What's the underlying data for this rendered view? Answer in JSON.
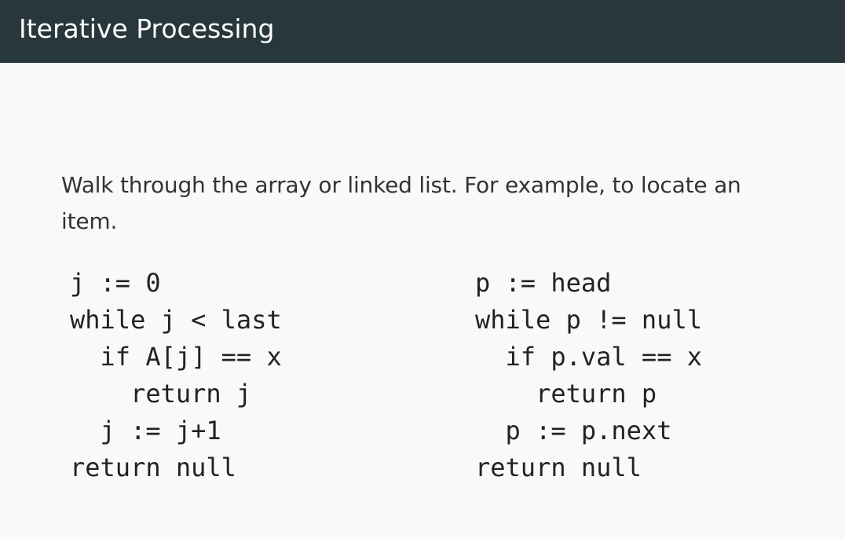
{
  "header": {
    "title": "Iterative Processing"
  },
  "body": {
    "intro": "Walk through the array or linked list. For example, to locate an item."
  },
  "code": {
    "array": [
      "j := 0",
      "while j < last",
      "  if A[j] == x",
      "    return j",
      "  j := j+1",
      "return null"
    ],
    "list": [
      "p := head",
      "while p != null",
      "  if p.val == x",
      "    return p",
      "  p := p.next",
      "return null"
    ]
  },
  "colors": {
    "header_background": "#28373c",
    "header_text": "#ffffff",
    "page_background": "#f9f9f9",
    "body_text": "#333333"
  }
}
